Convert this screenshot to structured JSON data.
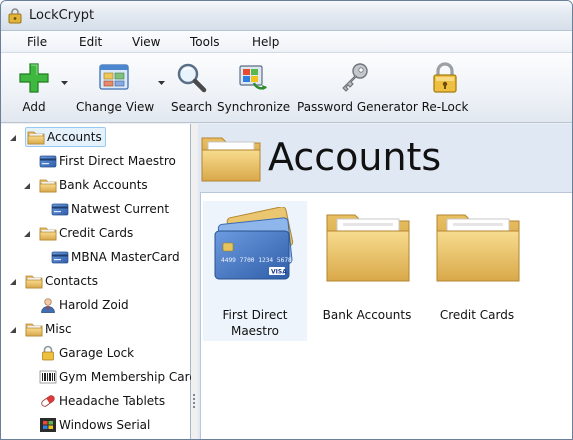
{
  "window": {
    "title": "LockCrypt"
  },
  "menu": [
    "File",
    "Edit",
    "View",
    "Tools",
    "Help"
  ],
  "toolbar": {
    "add": "Add",
    "change_view": "Change View",
    "search": "Search",
    "synchronize": "Synchronize",
    "password_generator": "Password Generator",
    "relock": "Re-Lock"
  },
  "tree": {
    "accounts": "Accounts",
    "first_direct": "First Direct Maestro",
    "bank_accounts": "Bank Accounts",
    "natwest": "Natwest Current",
    "credit_cards": "Credit Cards",
    "mbna": "MBNA MasterCard",
    "contacts": "Contacts",
    "harold": "Harold Zoid",
    "misc": "Misc",
    "garage": "Garage Lock",
    "gym": "Gym Membership Card",
    "headache": "Headache Tablets",
    "windows_serial": "Windows Serial"
  },
  "content": {
    "title": "Accounts",
    "items": {
      "first_direct_line1": "First Direct",
      "first_direct_line2": "Maestro",
      "bank_accounts": "Bank Accounts",
      "credit_cards": "Credit Cards"
    }
  },
  "card_art": {
    "number": "4499 7700 1234 5678",
    "brand": "VISA"
  },
  "colors": {
    "folder": "#e9c66f",
    "selection": "#e5f1fb",
    "content_bg": "#dfe8f3",
    "card_blue": "#3f73c2"
  },
  "icons": [
    "app-icon",
    "add-icon",
    "change-view-icon",
    "search-icon",
    "synchronize-icon",
    "key-icon",
    "padlock-icon",
    "folder-icon",
    "card-icon",
    "person-icon",
    "pill-icon",
    "barcode-icon"
  ]
}
